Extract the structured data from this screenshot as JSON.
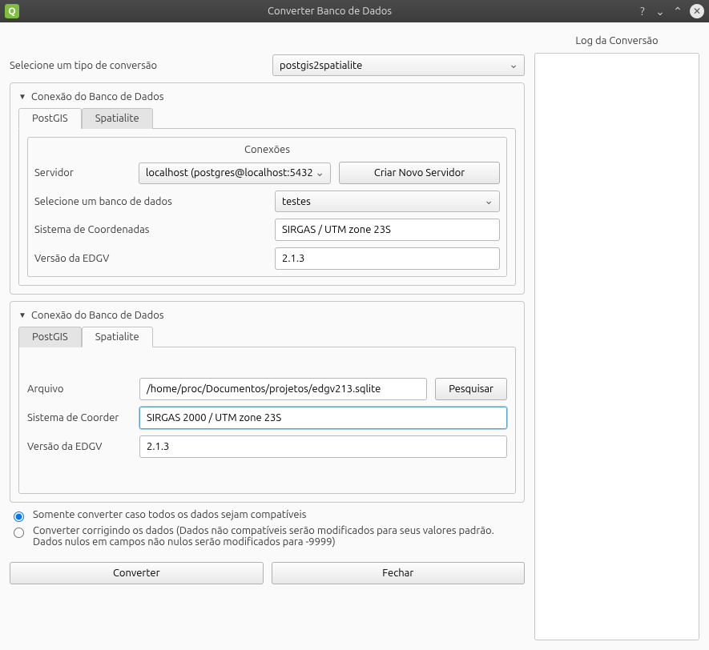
{
  "window": {
    "title": "Converter Banco de Dados"
  },
  "conversion_type": {
    "label": "Selecione um tipo de conversão",
    "selected": "postgis2spatialite"
  },
  "group1": {
    "title": "Conexão do Banco de Dados",
    "tabs": {
      "postgis": "PostGIS",
      "spatialite": "Spatialite"
    },
    "connections_title": "Conexões",
    "server_label": "Servidor",
    "server_selected": "localhost (postgres@localhost:5432)",
    "create_server_btn": "Criar Novo Servidor",
    "select_db_label": "Selecione um banco de dados",
    "db_selected": "testes",
    "crs_label": "Sistema de Coordenadas",
    "crs_value": "SIRGAS / UTM zone 23S",
    "edgv_label": "Versão da EDGV",
    "edgv_value": "2.1.3"
  },
  "group2": {
    "title": "Conexão do Banco de Dados",
    "tabs": {
      "postgis": "PostGIS",
      "spatialite": "Spatialite"
    },
    "file_label": "Arquivo",
    "file_value": "/home/proc/Documentos/projetos/edgv213.sqlite",
    "browse_btn": "Pesquisar",
    "crs_label": "Sistema de Coorder",
    "crs_value": "SIRGAS 2000 / UTM zone 23S",
    "edgv_label": "Versão da EDGV",
    "edgv_value": "2.1.3"
  },
  "options": {
    "radio1": "Somente converter caso todos os dados sejam compatíveis",
    "radio2": "Converter corrigindo os dados (Dados não compatíveis serão modificados para seus valores padrão. Dados nulos em campos não nulos serão modificados para -9999)",
    "selected": "radio1"
  },
  "buttons": {
    "convert": "Converter",
    "close": "Fechar"
  },
  "log": {
    "title": "Log da Conversão"
  }
}
